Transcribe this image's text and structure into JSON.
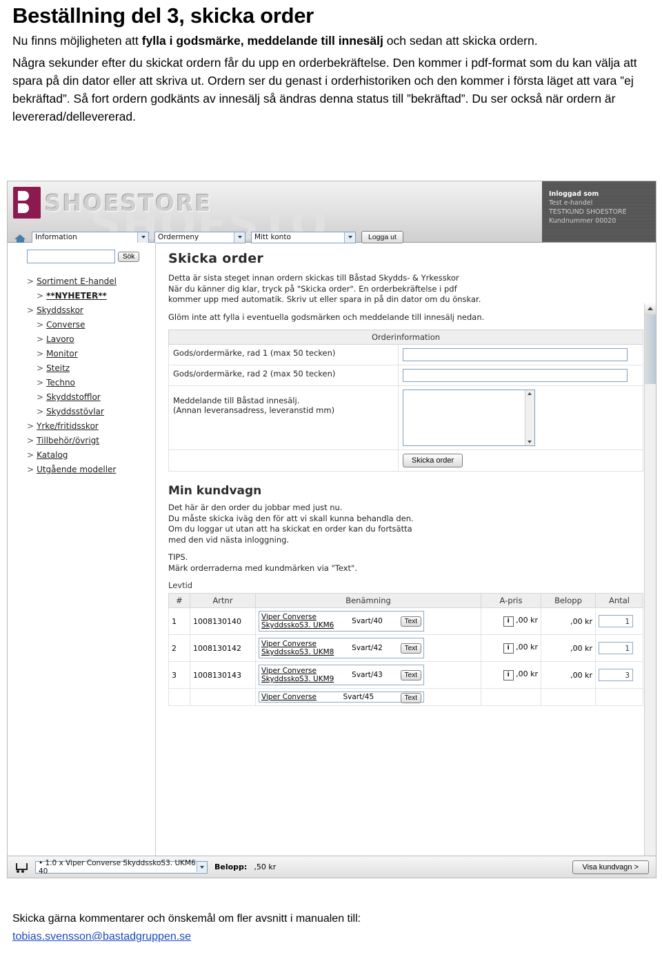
{
  "doc": {
    "title": "Beställning del 3, skicka order",
    "p1_a": "Nu finns möjligheten att ",
    "p1_b": "fylla i godsmärke, meddelande till innesälj",
    "p1_c": " och sedan att skicka ordern.",
    "p2": "Några sekunder efter du skickat ordern får du upp en orderbekräftelse. Den kommer i pdf-format som du kan välja att spara på din dator eller att skriva ut. Ordern ser du genast i orderhistoriken och den kommer i första läget att vara ”ej bekräftad”. Så fort ordern godkänts av innesälj så ändras denna status till ”bekräftad”. Du ser också när ordern är levererad/dellevererad."
  },
  "screenshot": {
    "brand": {
      "logo_text": "SHOESTORE",
      "ghost_text": "SHOESTO"
    },
    "login": {
      "line1": "Inloggad som",
      "line2": "Test e-handel",
      "line3": "TESTKUND SHOESTORE",
      "line4": "Kundnummer 00020"
    },
    "nav": {
      "home_icon": "home-icon",
      "menu1": "Information",
      "menu2": "Ordermeny",
      "menu3": "Mitt konto",
      "logout": "Logga ut"
    },
    "sidebar": {
      "search_value": "",
      "search_button": "Sök",
      "items": [
        {
          "label": "Sortiment E-handel",
          "level": 1
        },
        {
          "label": "**NYHETER**",
          "level": 2
        },
        {
          "label": "Skyddsskor",
          "level": 1
        },
        {
          "label": "Converse",
          "level": 2
        },
        {
          "label": "Lavoro",
          "level": 2
        },
        {
          "label": "Monitor",
          "level": 2
        },
        {
          "label": "Steitz",
          "level": 2
        },
        {
          "label": "Techno",
          "level": 2
        },
        {
          "label": "Skyddstofflor",
          "level": 2
        },
        {
          "label": "Skyddsstövlar",
          "level": 2
        },
        {
          "label": "Yrke/fritidsskor",
          "level": 1
        },
        {
          "label": "Tillbehör/övrigt",
          "level": 1
        },
        {
          "label": "Katalog",
          "level": 1
        },
        {
          "label": "Utgående modeller",
          "level": 1
        }
      ]
    },
    "main": {
      "heading": "Skicka order",
      "para1_l1": "Detta är sista steget innan ordern skickas till Båstad Skydds- & Yrkesskor",
      "para1_l2": "När du känner dig klar, tryck på \"Skicka order\". En orderbekräftelse i pdf",
      "para1_l3": "kommer upp med automatik. Skriv ut eller spara in på din dator om du önskar.",
      "para2": "Glöm inte att fylla i eventuella godsmärken och meddelande till innesälj nedan.",
      "orderinfo_header": "Orderinformation",
      "row1_label": "Gods/ordermärke, rad 1 (max 50 tecken)",
      "row1_value": "",
      "row2_label": "Gods/ordermärke, rad 2 (max 50 tecken)",
      "row2_value": "",
      "msg_label_l1": "Meddelande till Båstad innesälj.",
      "msg_label_l2": "(Annan leveransadress, leveranstid mm)",
      "msg_value": "",
      "send_button": "Skicka order",
      "cart_heading": "Min kundvagn",
      "cart_text_l1": "Det här är den order du jobbar med just nu.",
      "cart_text_l2": "Du måste skicka iväg den för att vi skall kunna behandla den.",
      "cart_text_l3": "Om du loggar ut utan att ha skickat en order kan du fortsätta",
      "cart_text_l4": "med den vid nästa inloggning.",
      "tips_l1": "TIPS.",
      "tips_l2": "Märk orderraderna med kundmärken via \"Text\".",
      "levtid_label": "Levtid",
      "table": {
        "headers": [
          "#",
          "Artnr",
          "Benämning",
          "A-pris",
          "Belopp",
          "Antal"
        ],
        "rows": [
          {
            "num": "1",
            "artnr": "1008130140",
            "name_l1": "Viper Converse",
            "name_l2": "SkyddsskoS3. UKM6",
            "variant": "Svart/40",
            "text_btn": "Text",
            "apris": ",00 kr",
            "belopp": ",00 kr",
            "antal": "1"
          },
          {
            "num": "2",
            "artnr": "1008130142",
            "name_l1": "Viper Converse",
            "name_l2": "SkyddsskoS3. UKM8",
            "variant": "Svart/42",
            "text_btn": "Text",
            "apris": ",00 kr",
            "belopp": ",00 kr",
            "antal": "1"
          },
          {
            "num": "3",
            "artnr": "1008130143",
            "name_l1": "Viper Converse",
            "name_l2": "SkyddsskoS3. UKM9",
            "variant": "Svart/43",
            "text_btn": "Text",
            "apris": ",00 kr",
            "belopp": ",00 kr",
            "antal": "3"
          },
          {
            "num": "",
            "artnr": "",
            "name_l1": "Viper Converse",
            "name_l2": "",
            "variant": "Svart/45",
            "text_btn": "Text",
            "apris": "",
            "belopp": "",
            "antal": ""
          }
        ]
      }
    },
    "bottombar": {
      "cart_summary": "• 1.0 x Viper Converse SkyddsskoS3. UKM6  40",
      "belopp_label": "Belopp:",
      "belopp_value": ",50 kr",
      "view_cart_button": "Visa kundvagn >"
    }
  },
  "footer": {
    "text": "Skicka gärna kommentarer och önskemål om fler avsnitt i manualen till:",
    "email": "tobias.svensson@bastadgruppen.se"
  }
}
